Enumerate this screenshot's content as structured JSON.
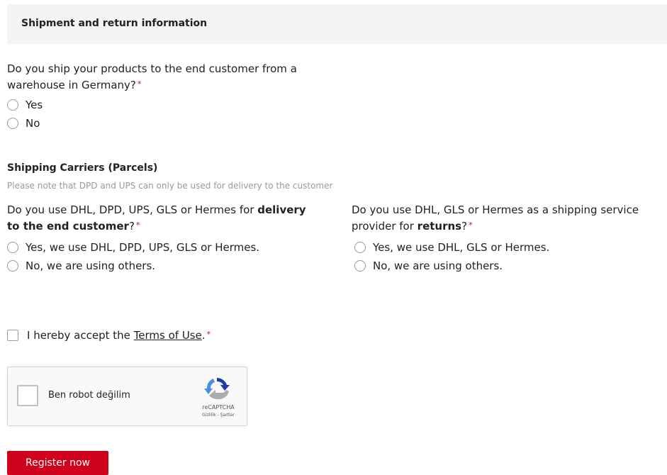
{
  "section": {
    "title": "Shipment and return information"
  },
  "warehouse": {
    "question_line1": "Do you ship your products to the end customer from a",
    "question_line2": "warehouse in Germany?",
    "required": "*",
    "options": [
      "Yes",
      "No"
    ]
  },
  "carriers": {
    "title": "Shipping Carriers (Parcels)",
    "note": "Please note that DPD and UPS can only be used for delivery to the customer",
    "delivery": {
      "q_part1": "Do you use DHL, DPD, UPS, GLS or Hermes for ",
      "q_bold1": "delivery",
      "q_bold2": "to the end customer",
      "q_end": "?",
      "required": "*",
      "options": [
        "Yes, we use DHL, DPD, UPS, GLS or Hermes.",
        "No, we are using others."
      ]
    },
    "returns": {
      "q_part1": "Do you use DHL, GLS or Hermes as a shipping service",
      "q_part2": "provider for ",
      "q_bold": "returns",
      "q_end": "?",
      "required": "*",
      "options": [
        "Yes, we use DHL, GLS or Hermes.",
        "No, we are using others."
      ]
    }
  },
  "terms": {
    "prefix": "I hereby accept the ",
    "link": "Terms of Use",
    "suffix": ".",
    "required": "*"
  },
  "captcha": {
    "label": "Ben robot değilim",
    "brand": "reCAPTCHA",
    "links": "Gizlilik - Şartlar"
  },
  "submit": {
    "label": "Register now"
  },
  "colors": {
    "accent": "#d0021b",
    "header_bg": "#f4f4f4",
    "note": "#9a9a9a"
  }
}
